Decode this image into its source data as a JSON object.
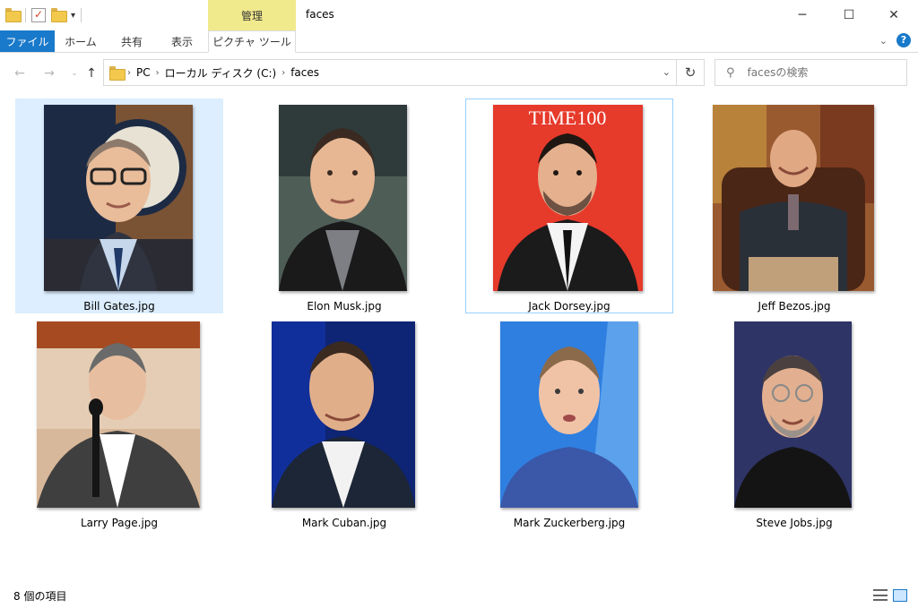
{
  "window": {
    "title": "faces",
    "context_tab_group": "管理",
    "controls": {
      "minimize": "─",
      "maximize": "☐",
      "close": "✕"
    }
  },
  "ribbon": {
    "tabs": [
      "ファイル",
      "ホーム",
      "共有",
      "表示",
      "ピクチャ ツール"
    ],
    "help": "?"
  },
  "address": {
    "segments": [
      "PC",
      "ローカル ディスク (C:)",
      "faces"
    ]
  },
  "search": {
    "placeholder": "facesの検索"
  },
  "files": [
    {
      "name": "Bill Gates.jpg",
      "bg": "#8a6a4a",
      "accent": "#1f3a68"
    },
    {
      "name": "Elon Musk.jpg",
      "bg": "#4a5a54",
      "accent": "#2a2a2a"
    },
    {
      "name": "Jack Dorsey.jpg",
      "bg": "#e33a2a",
      "accent": "#1b1b1b",
      "banner": "TIME100"
    },
    {
      "name": "Jeff Bezos.jpg",
      "bg": "#8a4a2a",
      "accent": "#2a2f38"
    },
    {
      "name": "Larry Page.jpg",
      "bg": "#c9a98a",
      "accent": "#4a4a4a"
    },
    {
      "name": "Mark Cuban.jpg",
      "bg": "#0e2a7a",
      "accent": "#1e2a3a"
    },
    {
      "name": "Mark Zuckerberg.jpg",
      "bg": "#2a7ad8",
      "accent": "#2a4a9a"
    },
    {
      "name": "Steve Jobs.jpg",
      "bg": "#3a3a6a",
      "accent": "#151515"
    }
  ],
  "status": {
    "item_count": "8 個の項目"
  },
  "colors": {
    "file_tab": "#1979ca",
    "context_tab": "#f1ea8c",
    "selection": "#dceeff",
    "focus_border": "#99d1ff"
  }
}
